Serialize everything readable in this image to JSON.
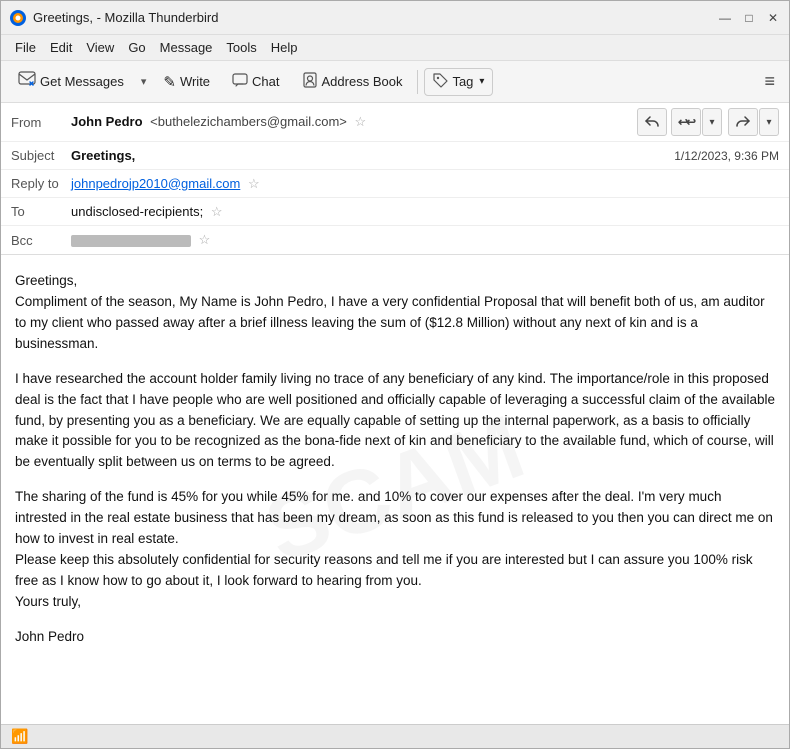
{
  "window": {
    "title": "Greetings, - Mozilla Thunderbird",
    "logo_alt": "Thunderbird"
  },
  "title_controls": {
    "minimize": "—",
    "maximize": "□",
    "close": "✕"
  },
  "menu": {
    "items": [
      "File",
      "Edit",
      "View",
      "Go",
      "Message",
      "Tools",
      "Help"
    ]
  },
  "toolbar": {
    "get_messages": "Get Messages",
    "write": "Write",
    "chat": "Chat",
    "address_book": "Address Book",
    "tag": "Tag",
    "hamburger": "≡"
  },
  "email": {
    "from_label": "From",
    "from_name": "John Pedro",
    "from_email": "<buthelezichambers@gmail.com>",
    "reply_to_label": "Reply to",
    "reply_to": "johnpedrojp2010@gmail.com",
    "to_label": "To",
    "to_value": "undisclosed-recipients;",
    "bcc_label": "Bcc",
    "subject_label": "Subject",
    "subject": "Greetings,",
    "date": "1/12/2023, 9:36 PM",
    "body_paragraphs": [
      "Greetings,\nCompliment of the season, My Name is John Pedro, I have a very confidential Proposal that will benefit both of us, am auditor to my client who passed away after a brief illness leaving the sum of ($12.8 Million) without any next of kin and is a businessman.",
      "I have researched the account holder family living no trace of any beneficiary of any kind. The importance/role in this proposed deal is the fact that I have people who are well positioned and officially capable of leveraging a successful claim of the available fund, by presenting you as a beneficiary. We are equally capable of setting up the internal paperwork, as a basis to officially make it possible for you to be recognized as the bona-fide next of kin and beneficiary to the available fund, which of course, will be eventually split between us on terms to be agreed.",
      "The sharing of the fund is 45% for you while 45% for me. and 10% to cover our expenses after the deal. I'm very much intrested in the real estate business that has been my dream, as soon as this fund is released to you then you can direct me on how to invest in real estate.\nPlease keep this absolutely confidential for security reasons and tell me if you are interested but I can assure you 100% risk free as I know how to go about it, I look forward to hearing from you.\nYours truly,",
      "John Pedro"
    ]
  },
  "status_bar": {
    "icon": "📶",
    "text": ""
  },
  "icons": {
    "star": "☆",
    "reply": "↩",
    "reply_all": "⤺",
    "dropdown": "▾",
    "forward": "→",
    "pencil": "✎",
    "chat_bubble": "💬",
    "address_icon": "👤",
    "tag_icon": "🏷",
    "get_msg_icon": "⬇"
  }
}
